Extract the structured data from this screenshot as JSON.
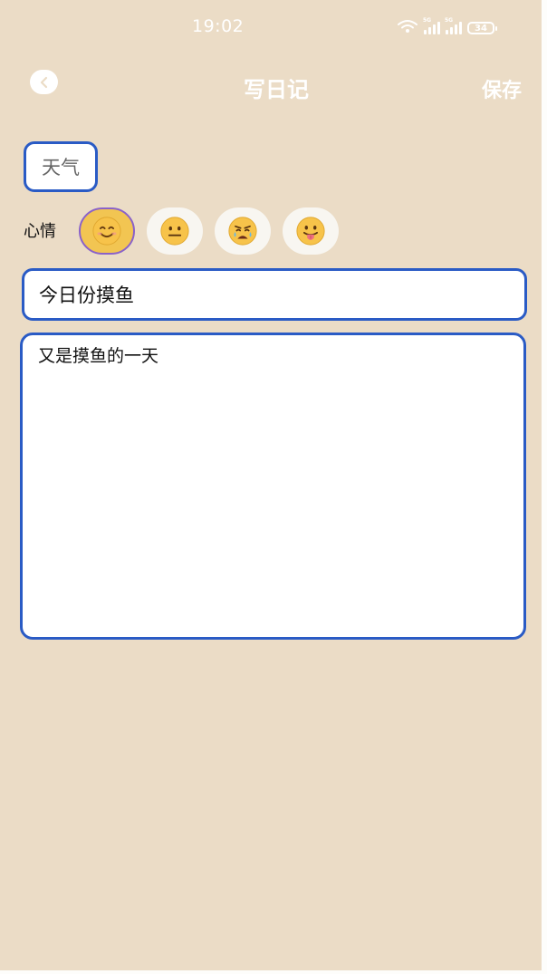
{
  "status_bar": {
    "time": "19:02",
    "battery": "34",
    "network_tag": "5G"
  },
  "header": {
    "title": "写日记",
    "save_label": "保存"
  },
  "weather": {
    "label": "天气"
  },
  "mood": {
    "label": "心情",
    "options": [
      {
        "name": "smiling",
        "selected": true
      },
      {
        "name": "neutral",
        "selected": false
      },
      {
        "name": "sad",
        "selected": false
      },
      {
        "name": "tongue-out",
        "selected": false
      }
    ]
  },
  "diary": {
    "title": "今日份摸鱼",
    "content": "又是摸鱼的一天"
  },
  "colors": {
    "background": "#ebdcc6",
    "accent": "#2a5bc5",
    "selected_mood": "#f2c552",
    "selected_ring": "#8a62c9"
  }
}
